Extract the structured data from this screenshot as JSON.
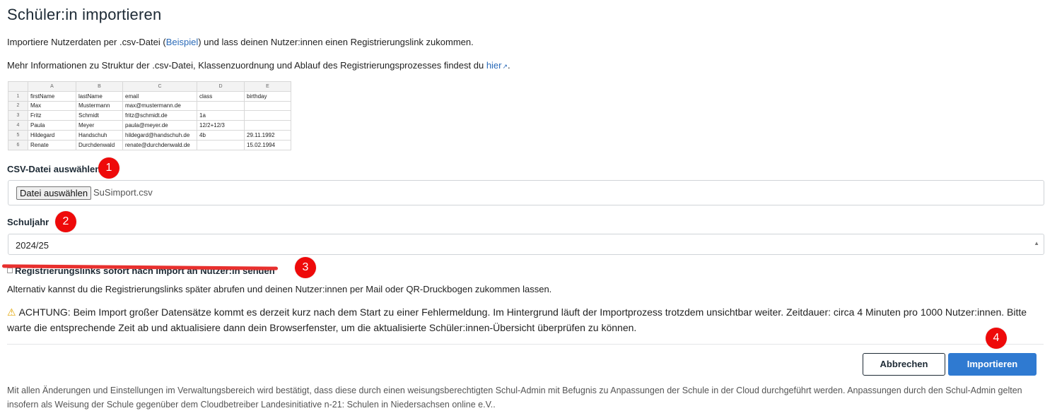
{
  "title": "Schüler:in importieren",
  "intro": {
    "before": "Importiere Nutzerdaten per .csv-Datei (",
    "link": "Beispiel",
    "after": ") und lass deinen Nutzer:innen einen Registrierungslink zukommen."
  },
  "info": {
    "before": "Mehr Informationen zu Struktur der .csv-Datei, Klassenzuordnung und Ablauf des Registrierungsprozesses findest du ",
    "link": "hier",
    "after": "."
  },
  "sheet": {
    "columns": [
      "A",
      "B",
      "C",
      "D",
      "E"
    ],
    "rows": [
      {
        "n": "1",
        "cells": [
          "firstName",
          "lastName",
          "email",
          "class",
          "birthday"
        ]
      },
      {
        "n": "2",
        "cells": [
          "Max",
          "Mustermann",
          "max@mustermann.de",
          "",
          ""
        ]
      },
      {
        "n": "3",
        "cells": [
          "Fritz",
          "Schmidt",
          "fritz@schmidt.de",
          "1a",
          ""
        ]
      },
      {
        "n": "4",
        "cells": [
          "Paula",
          "Meyer",
          "paula@meyer.de",
          "12/2+12/3",
          ""
        ]
      },
      {
        "n": "5",
        "cells": [
          "Hildegard",
          "Handschuh",
          "hildegard@handschuh.de",
          "4b",
          "29.11.1992"
        ]
      },
      {
        "n": "6",
        "cells": [
          "Renate",
          "Durchdenwald",
          "renate@durchdenwald.de",
          "",
          "15.02.1994"
        ]
      }
    ]
  },
  "csv_label": "CSV-Datei auswählen",
  "file_button": "Datei auswählen",
  "file_name": "SuSimport.csv",
  "year_label": "Schuljahr",
  "year_value": "2024/25",
  "checkbox_label": "Registrierungslinks sofort nach Import an Nutzer:in senden",
  "alt_text": "Alternativ kannst du die Registrierungslinks später abrufen und deinen Nutzer:innen per Mail oder QR-Druckbogen zukommen lassen.",
  "warning": "ACHTUNG: Beim Import großer Datensätze kommt es derzeit kurz nach dem Start zu einer Fehlermeldung. Im Hintergrund läuft der Importprozess trotzdem unsichtbar weiter. Zeitdauer: circa 4 Minuten pro 1000 Nutzer:innen. Bitte warte die entsprechende Zeit ab und aktualisiere dann dein Browserfenster, um die aktualisierte Schüler:innen-Übersicht überprüfen zu können.",
  "cancel_label": "Abbrechen",
  "import_label": "Importieren",
  "footer": "Mit allen Änderungen und Einstellungen im Verwaltungsbereich wird bestätigt, dass diese durch einen weisungsberechtigten Schul-Admin mit Befugnis zu Anpassungen der Schule in der Cloud durchgeführt werden. Anpassungen durch den Schul-Admin gelten insofern als Weisung der Schule gegenüber dem Cloudbetreiber Landesinitiative n-21: Schulen in Niedersachsen online e.V..",
  "markers": [
    "1",
    "2",
    "3",
    "4"
  ],
  "colors": {
    "accent": "#2f7ad1",
    "marker": "#ee0a0a",
    "warning_icon": "#e2a400",
    "strike": "#e8302e"
  },
  "icons": {
    "warning": "warning-icon",
    "external": "external-link-icon",
    "select": "chevron-down-icon"
  }
}
